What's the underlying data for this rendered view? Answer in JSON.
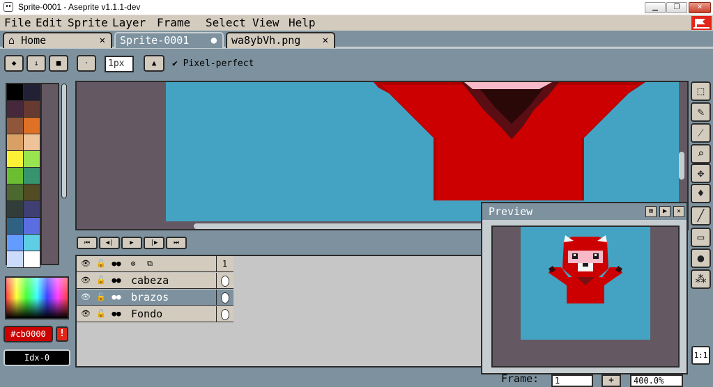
{
  "window": {
    "title": "Sprite-0001 - Aseprite v1.1.1-dev",
    "minimize": "▁",
    "maximize": "❐",
    "close": "✕"
  },
  "menu": [
    "File",
    "Edit",
    "Sprite",
    "Layer",
    "Frame",
    "Select",
    "View",
    "Help"
  ],
  "tabs": [
    {
      "label": "Home",
      "close": "✕",
      "icon": "home-icon"
    },
    {
      "label": "Sprite-0001",
      "close": "●"
    },
    {
      "label": "wa8ybVh.png",
      "close": "✕"
    }
  ],
  "context": {
    "brush_size_placeholder": "1px",
    "pixel_perfect_check": "✔",
    "pixel_perfect": "Pixel-perfect"
  },
  "palette_colors": [
    "#000000",
    "#222034",
    "#45283c",
    "#663931",
    "#8f563b",
    "#df7126",
    "#d9a066",
    "#eec39a",
    "#fbf236",
    "#99e550",
    "#6abe30",
    "#37946e",
    "#4b692f",
    "#524b24",
    "#323c39",
    "#3f3f74",
    "#306082",
    "#5b6ee1",
    "#639bff",
    "#5fcde4",
    "#cbdbfc",
    "#ffffff"
  ],
  "colors": {
    "foreground": "#cb0000",
    "foreground_label": "#cb0000",
    "warning": "!",
    "background_label": "Idx-0",
    "ui_bg": "#7d929e",
    "canvas_sky": "#44a3c2",
    "checker": "#645863"
  },
  "animation": [
    "⏮",
    "◀|",
    "▶",
    "|▶",
    "⏭"
  ],
  "timeline": {
    "frame_header": "1",
    "header_icons": [
      "eye-icon",
      "lock-icon",
      "dots-icon",
      "gear-icon",
      "onion-skin-icon"
    ],
    "layers": [
      {
        "name": "cabeza",
        "selected": false
      },
      {
        "name": "brazos",
        "selected": true
      },
      {
        "name": "Fondo",
        "selected": false
      }
    ]
  },
  "preview": {
    "title": "Preview",
    "buttons": [
      "⊞",
      "▶",
      "✕"
    ]
  },
  "tools": [
    "marquee-icon",
    "pencil-icon",
    "eyedropper-icon",
    "zoom-icon",
    "move-icon",
    "fill-icon",
    "line-icon",
    "rectangle-icon",
    "blur-icon",
    "spray-icon"
  ],
  "status": {
    "frame_label": "Frame:",
    "frame_value": "1",
    "frame_add": "+",
    "zoom": "400.0%",
    "one_to_one": "1:1"
  }
}
